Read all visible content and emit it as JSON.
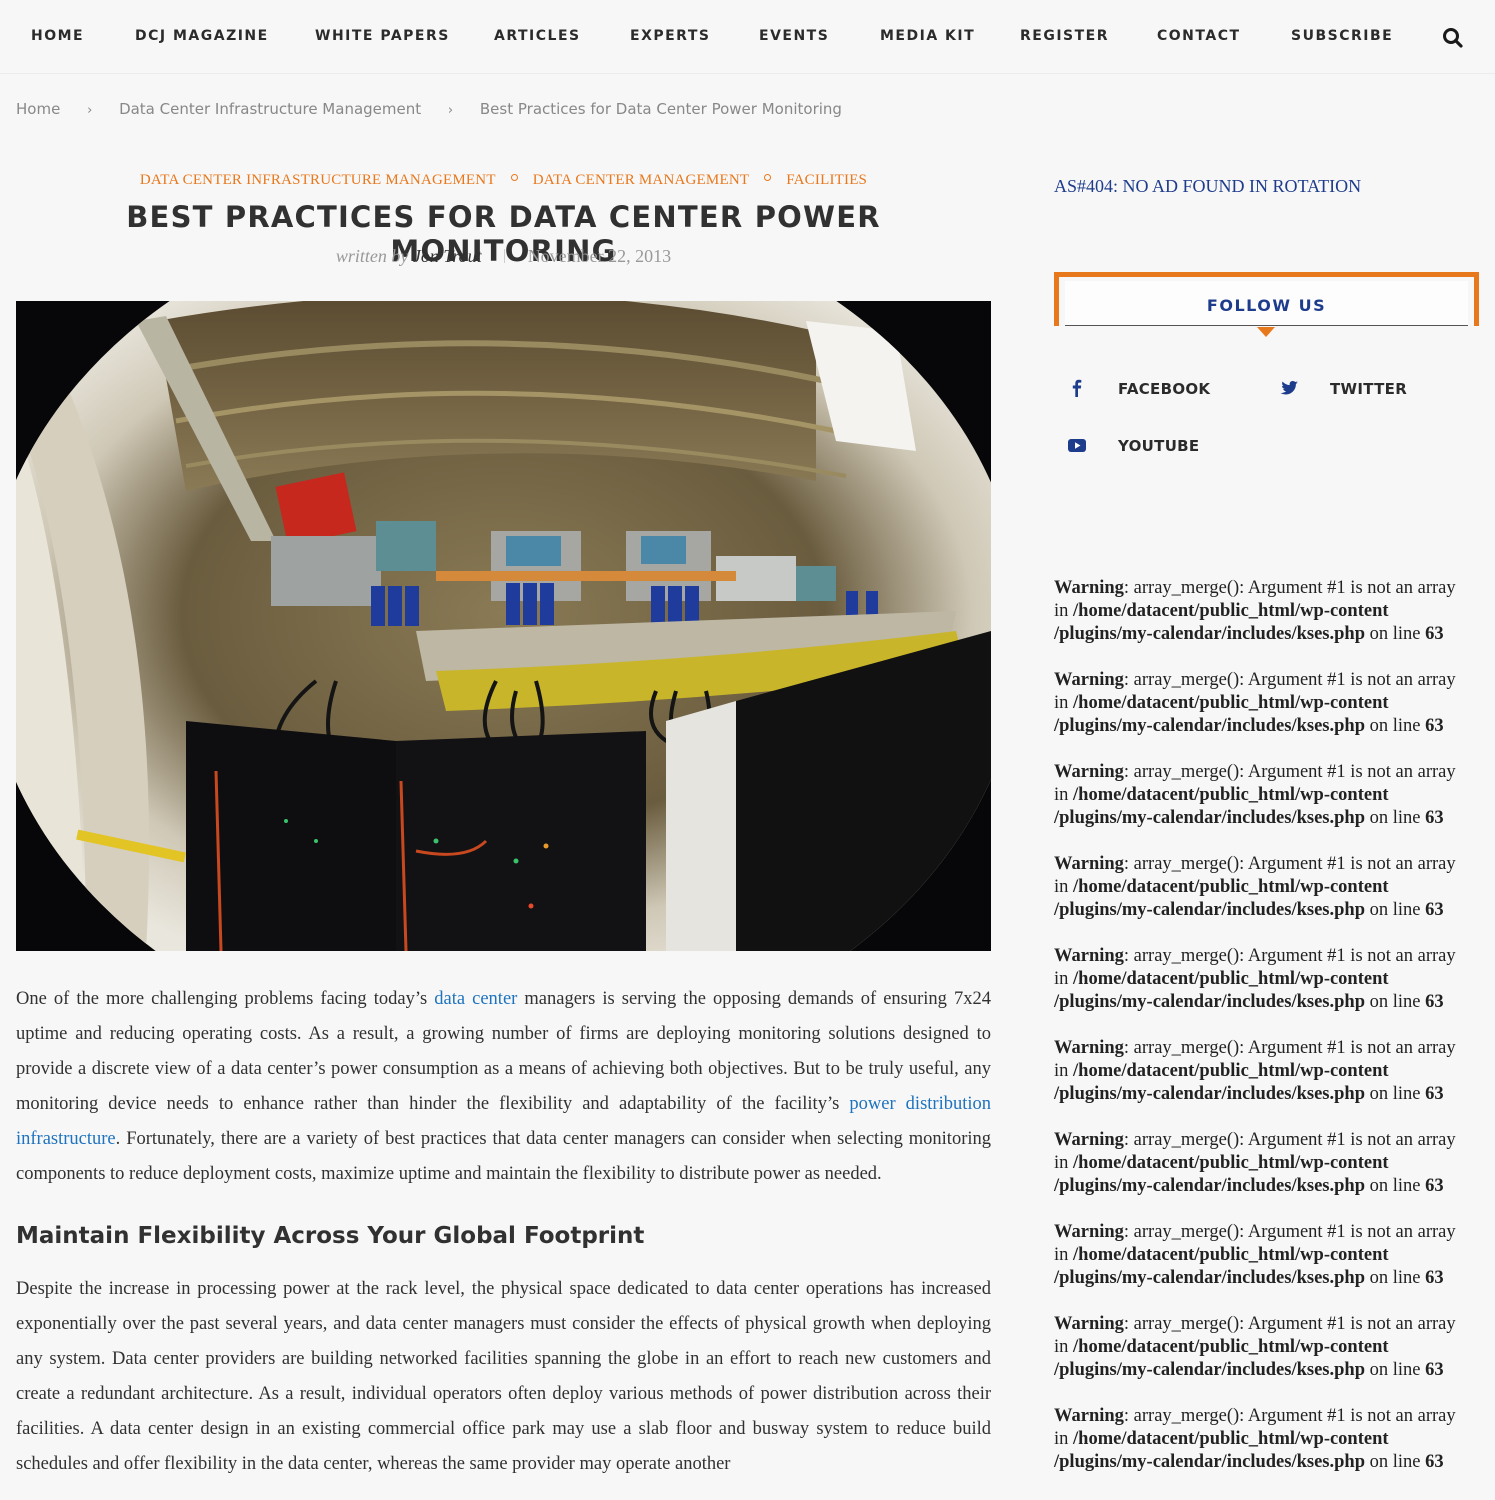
{
  "nav": {
    "items": [
      {
        "label": "HOME"
      },
      {
        "label": "DCJ MAGAZINE"
      },
      {
        "label": "WHITE PAPERS"
      },
      {
        "label": "ARTICLES"
      },
      {
        "label": "EXPERTS"
      },
      {
        "label": "EVENTS"
      },
      {
        "label": "MEDIA KIT"
      },
      {
        "label": "REGISTER"
      },
      {
        "label": "CONTACT"
      },
      {
        "label": "SUBSCRIBE"
      }
    ],
    "search_icon": "search-icon"
  },
  "breadcrumb": {
    "items": [
      {
        "label": "Home"
      },
      {
        "label": "Data Center Infrastructure Management"
      },
      {
        "label": "Best Practices for Data Center Power Monitoring"
      }
    ],
    "separator": "›"
  },
  "article": {
    "categories": [
      {
        "label": "DATA CENTER INFRASTRUCTURE MANAGEMENT"
      },
      {
        "label": "DATA CENTER MANAGEMENT"
      },
      {
        "label": "FACILITIES"
      }
    ],
    "title": "BEST PRACTICES FOR DATA CENTER POWER MONITORING",
    "written_by": "written by",
    "author": "Jon Trout",
    "date": "November 22, 2013",
    "hero_image_alt": "Fisheye view of data center power monitoring equipment and racks",
    "para1": {
      "t1": "One of the more challenging problems facing today’s ",
      "link1": "data center",
      "t2": " managers is serving the opposing demands of ensuring 7x24 uptime and reducing operating costs. As a result, a growing number of firms are deploying monitoring solutions designed to provide a discrete view of a data center’s power consumption as a means of achieving both objectives. But to be truly useful, any monitoring device needs to enhance rather than hinder the flexibility and adaptability of the facility’s ",
      "link2": "power distribution infrastructure",
      "t3": ". Fortunately, there are a variety of best practices that data center managers can consider when selecting monitoring components to reduce deployment costs, maximize uptime and maintain the flexibility to distribute power as needed."
    },
    "heading2": "Maintain Flexibility Across Your Global Footprint",
    "para2": "Despite the increase in processing power at the rack level, the physical space dedicated to data center operations has increased exponentially over the past several years, and data center managers must consider the effects of physical growth when deploying any system. Data center providers are building networked facilities spanning the globe in an effort to reach new customers and create a redundant architecture. As a result, individual operators often deploy various methods of power distribution across their facilities. A data center design in an existing commercial office park may use a slab floor and busway system to reduce build schedules and offer flexibility in the data center, whereas the same provider may operate another"
  },
  "sidebar": {
    "ad_text": "AS#404: NO AD FOUND IN ROTATION",
    "follow_title": "FOLLOW US",
    "social": [
      {
        "label": "FACEBOOK",
        "icon": "facebook-icon"
      },
      {
        "label": "TWITTER",
        "icon": "twitter-icon"
      },
      {
        "label": "YOUTUBE",
        "icon": "youtube-icon"
      }
    ],
    "warning": {
      "label": "Warning",
      "msg": ": array_merge(): Argument #1 is not an array",
      "in": "in ",
      "path1": "/home/datacent/public_html/wp-content",
      "path2": "/plugins/my-calendar/includes/kses.php",
      "on_line": " on line ",
      "line": "63",
      "count": 10
    }
  },
  "colors": {
    "accent": "#e8781c",
    "link": "#1e73be",
    "brand_blue": "#1e3c8c",
    "background": "#f7f7f7"
  }
}
